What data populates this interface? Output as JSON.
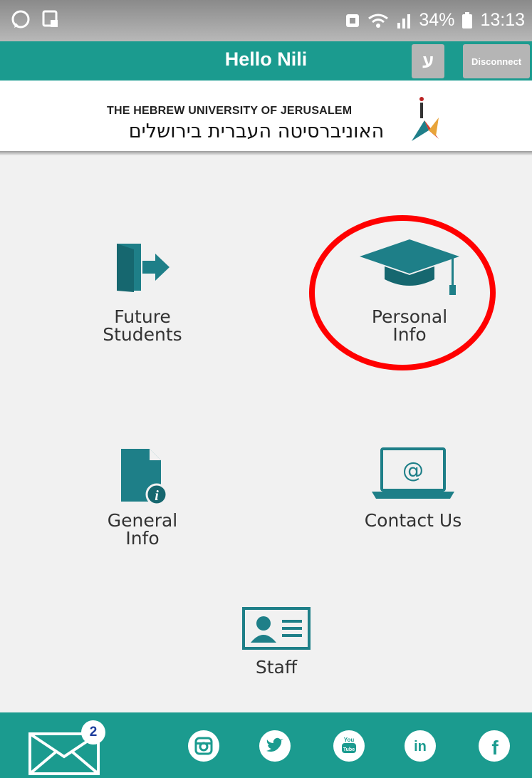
{
  "status_bar": {
    "battery": "34%",
    "time": "13:13"
  },
  "header": {
    "title": "Hello Nili",
    "lang_button": "ע",
    "disconnect_button": "Disconnect"
  },
  "logo": {
    "english": "THE HEBREW UNIVERSITY OF JERUSALEM",
    "hebrew": "האוניברסיטה העברית בירושלים"
  },
  "tiles": [
    {
      "label": "Future\nStudents",
      "icon": "door-enter-icon"
    },
    {
      "label": "Personal\nInfo",
      "icon": "graduation-cap-icon"
    },
    {
      "label": "General\nInfo",
      "icon": "document-info-icon"
    },
    {
      "label": "Contact Us",
      "icon": "laptop-at-icon"
    },
    {
      "label": "Staff",
      "icon": "id-card-icon"
    }
  ],
  "bottom_bar": {
    "messages_badge": "2",
    "social": [
      "instagram-icon",
      "twitter-icon",
      "youtube-icon",
      "linkedin-icon",
      "facebook-icon"
    ]
  },
  "colors": {
    "primary": "#1b9b8f",
    "icon": "#1e7f88",
    "highlight": "#ff0000"
  }
}
